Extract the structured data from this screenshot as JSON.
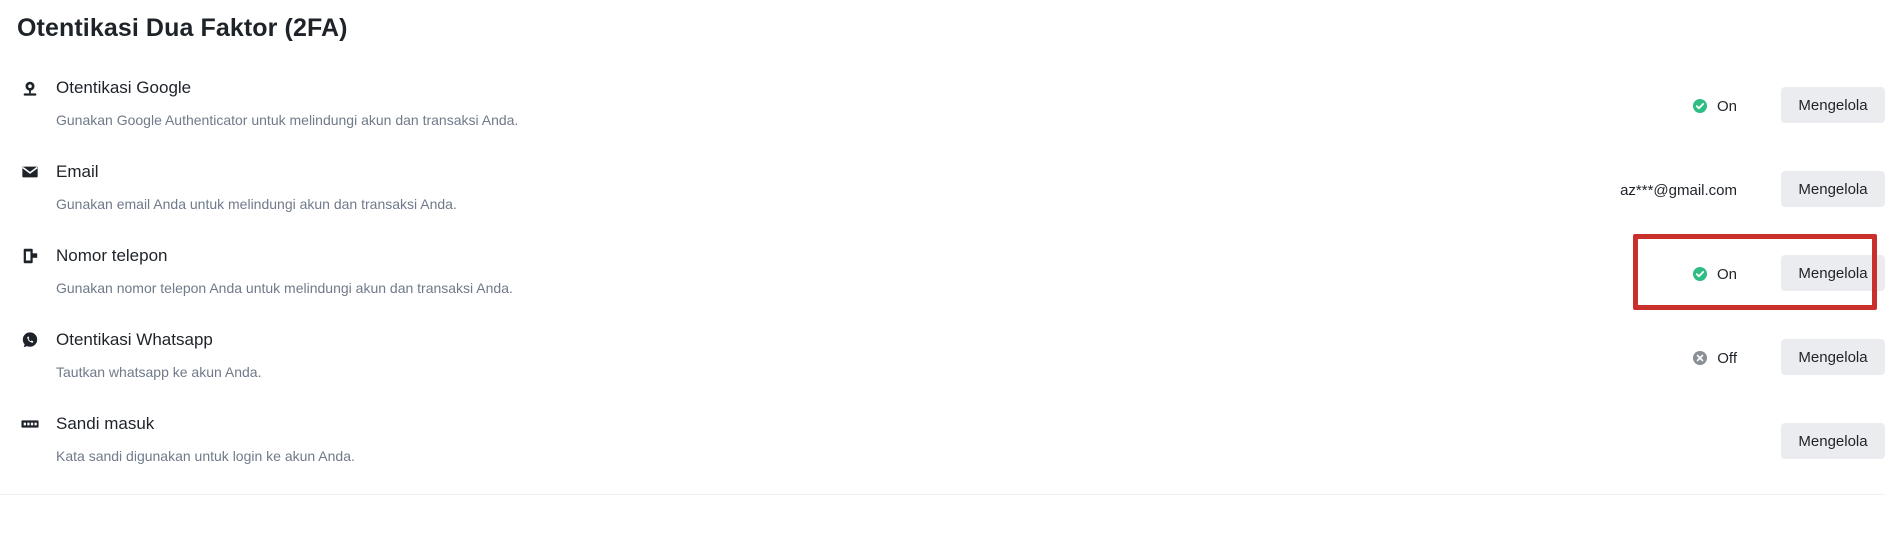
{
  "page": {
    "title": "Otentikasi Dua Faktor (2FA)"
  },
  "colors": {
    "status_on": "#2ebd85",
    "status_off": "#8a8f96",
    "highlight": "#c9302c",
    "button_bg": "#eaecef"
  },
  "items": [
    {
      "icon": "authenticator-icon",
      "title": "Otentikasi Google",
      "description": "Gunakan Google Authenticator untuk melindungi akun dan transaksi Anda.",
      "status": "On",
      "status_state": "on",
      "button": "Mengelola"
    },
    {
      "icon": "email-icon",
      "title": "Email",
      "description": "Gunakan email Anda untuk melindungi akun dan transaksi Anda.",
      "value": "az***@gmail.com",
      "button": "Mengelola"
    },
    {
      "icon": "phone-icon",
      "title": "Nomor telepon",
      "description": "Gunakan nomor telepon Anda untuk melindungi akun dan transaksi Anda.",
      "status": "On",
      "status_state": "on",
      "button": "Mengelola"
    },
    {
      "icon": "whatsapp-icon",
      "title": "Otentikasi Whatsapp",
      "description": "Tautkan whatsapp ke akun Anda.",
      "status": "Off",
      "status_state": "off",
      "button": "Mengelola"
    },
    {
      "icon": "password-icon",
      "title": "Sandi masuk",
      "description": "Kata sandi digunakan untuk login ke akun Anda.",
      "button": "Mengelola"
    }
  ]
}
